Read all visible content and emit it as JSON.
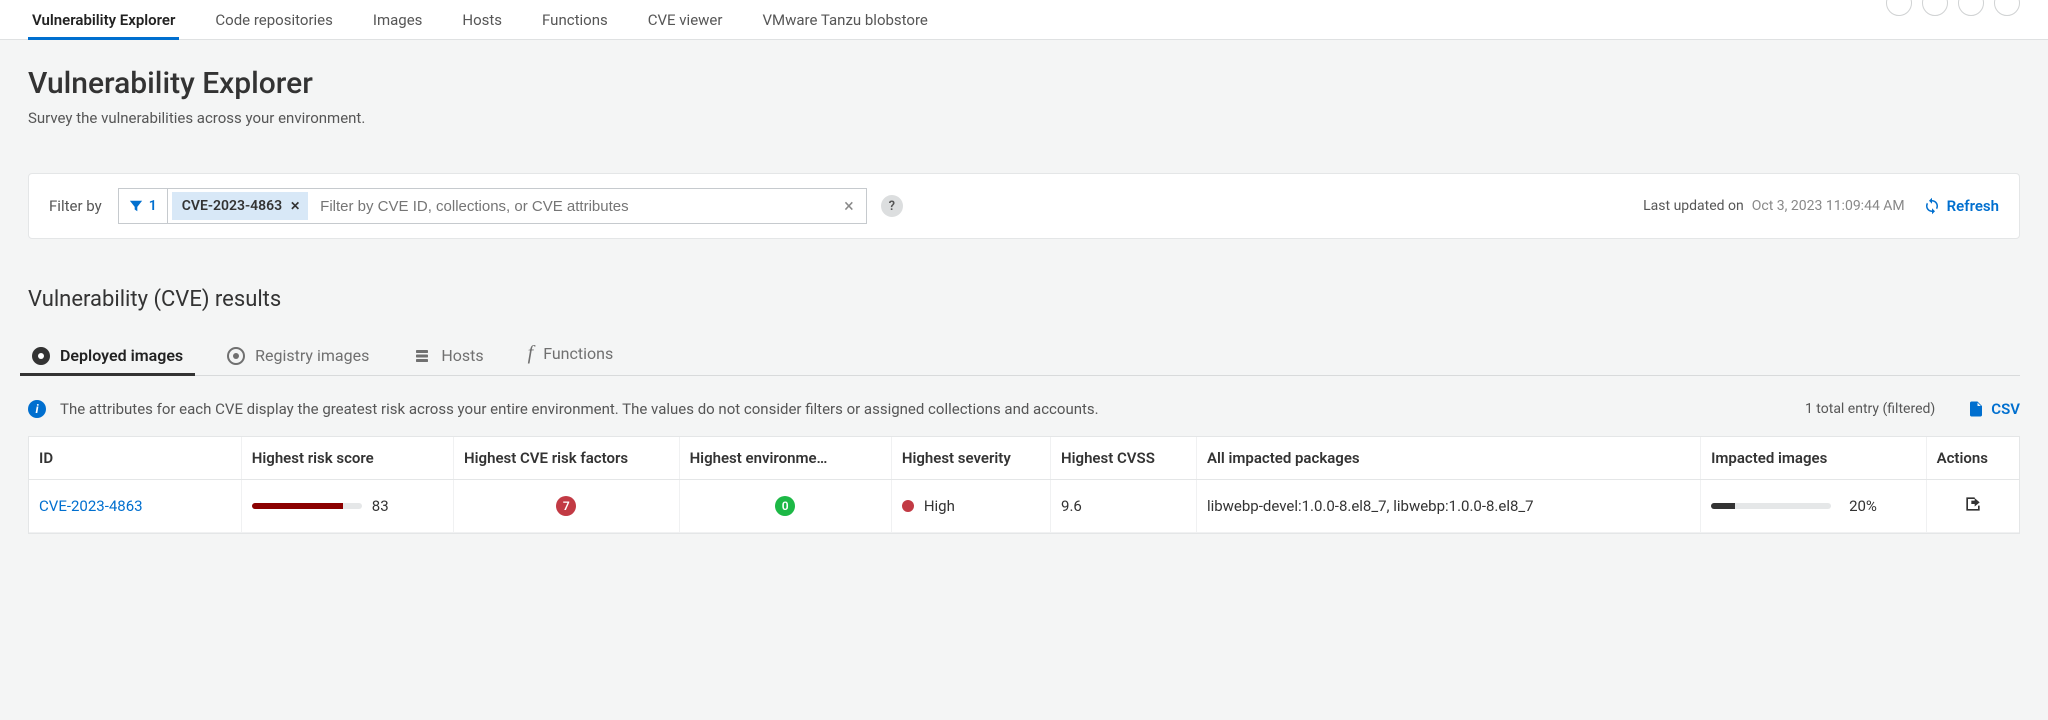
{
  "main_tabs": {
    "t0": "Vulnerability Explorer",
    "t1": "Code repositories",
    "t2": "Images",
    "t3": "Hosts",
    "t4": "Functions",
    "t5": "CVE viewer",
    "t6": "VMware Tanzu blobstore"
  },
  "page": {
    "title": "Vulnerability Explorer",
    "subtitle": "Survey the vulnerabilities across your environment."
  },
  "filter": {
    "label": "Filter by",
    "count": "1",
    "chip": "CVE-2023-4863",
    "placeholder": "Filter by CVE ID, collections, or CVE attributes",
    "last_updated_label": "Last updated on",
    "last_updated_value": "Oct 3, 2023 11:09:44 AM",
    "refresh": "Refresh"
  },
  "results": {
    "title": "Vulnerability (CVE) results",
    "tabs": {
      "deployed": "Deployed images",
      "registry": "Registry images",
      "hosts": "Hosts",
      "functions": "Functions"
    },
    "info": "The attributes for each CVE display the greatest risk across your entire environment. The values do not consider filters or assigned collections and accounts.",
    "total": "1 total entry (filtered)",
    "csv": "CSV"
  },
  "table": {
    "headers": {
      "id": "ID",
      "risk": "Highest risk score",
      "factors": "Highest CVE risk factors",
      "env": "Highest environme…",
      "sev": "Highest severity",
      "cvss": "Highest CVSS",
      "pkg": "All impacted packages",
      "impact": "Impacted images",
      "actions": "Actions"
    },
    "row": {
      "id": "CVE-2023-4863",
      "risk_score": "83",
      "risk_pct": 83,
      "factors": "7",
      "env": "0",
      "sev": "High",
      "cvss": "9.6",
      "pkg": "libwebp-devel:1.0.0-8.el8_7, libwebp:1.0.0-8.el8_7",
      "impact_pct": "20%",
      "impact_fill": 20
    }
  }
}
